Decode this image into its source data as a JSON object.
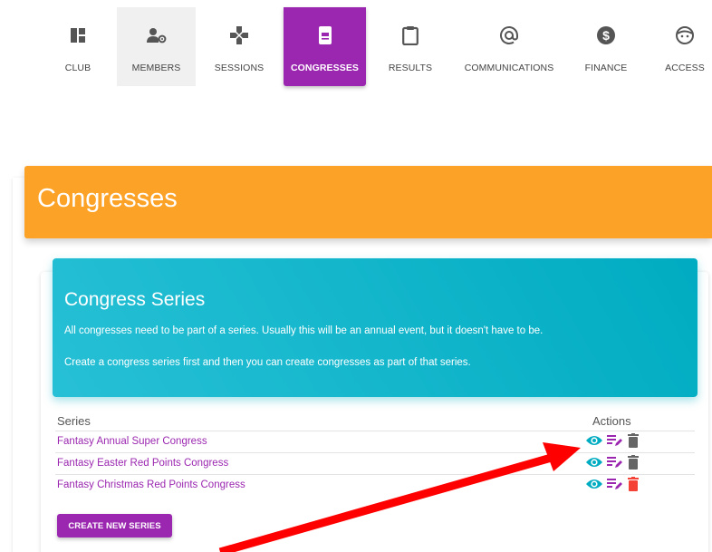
{
  "nav": {
    "items": [
      {
        "label": "CLUB",
        "icon": "dashboard-icon"
      },
      {
        "label": "MEMBERS",
        "icon": "members-settings-icon"
      },
      {
        "label": "SESSIONS",
        "icon": "gamepad-icon"
      },
      {
        "label": "CONGRESSES",
        "icon": "event-card-icon"
      },
      {
        "label": "RESULTS",
        "icon": "clipboard-icon"
      },
      {
        "label": "COMMUNICATIONS",
        "icon": "at-sign-icon"
      },
      {
        "label": "FINANCE",
        "icon": "dollar-circle-icon"
      },
      {
        "label": "ACCESS",
        "icon": "face-icon"
      }
    ],
    "active_color": "#9b27b0"
  },
  "header": {
    "title": "Congresses",
    "color": "#fca226"
  },
  "series_box": {
    "title": "Congress Series",
    "line1": "All congresses need to be part of a series. Usually this will be an annual event, but it doesn't have to be.",
    "line2": "Create a congress series first and then you can create congresses as part of that series.",
    "color": "#00acc1"
  },
  "table": {
    "col_series": "Series",
    "col_actions": "Actions",
    "rows": [
      {
        "name": "Fantasy Annual Super Congress",
        "delete_color": "#666666"
      },
      {
        "name": "Fantasy Easter Red Points Congress",
        "delete_color": "#666666"
      },
      {
        "name": "Fantasy Christmas Red Points Congress",
        "delete_color": "#f44336"
      }
    ]
  },
  "create_button": "CREATE NEW SERIES",
  "annotation": {
    "color": "#ff0000",
    "icon": "red-arrow-icon"
  }
}
